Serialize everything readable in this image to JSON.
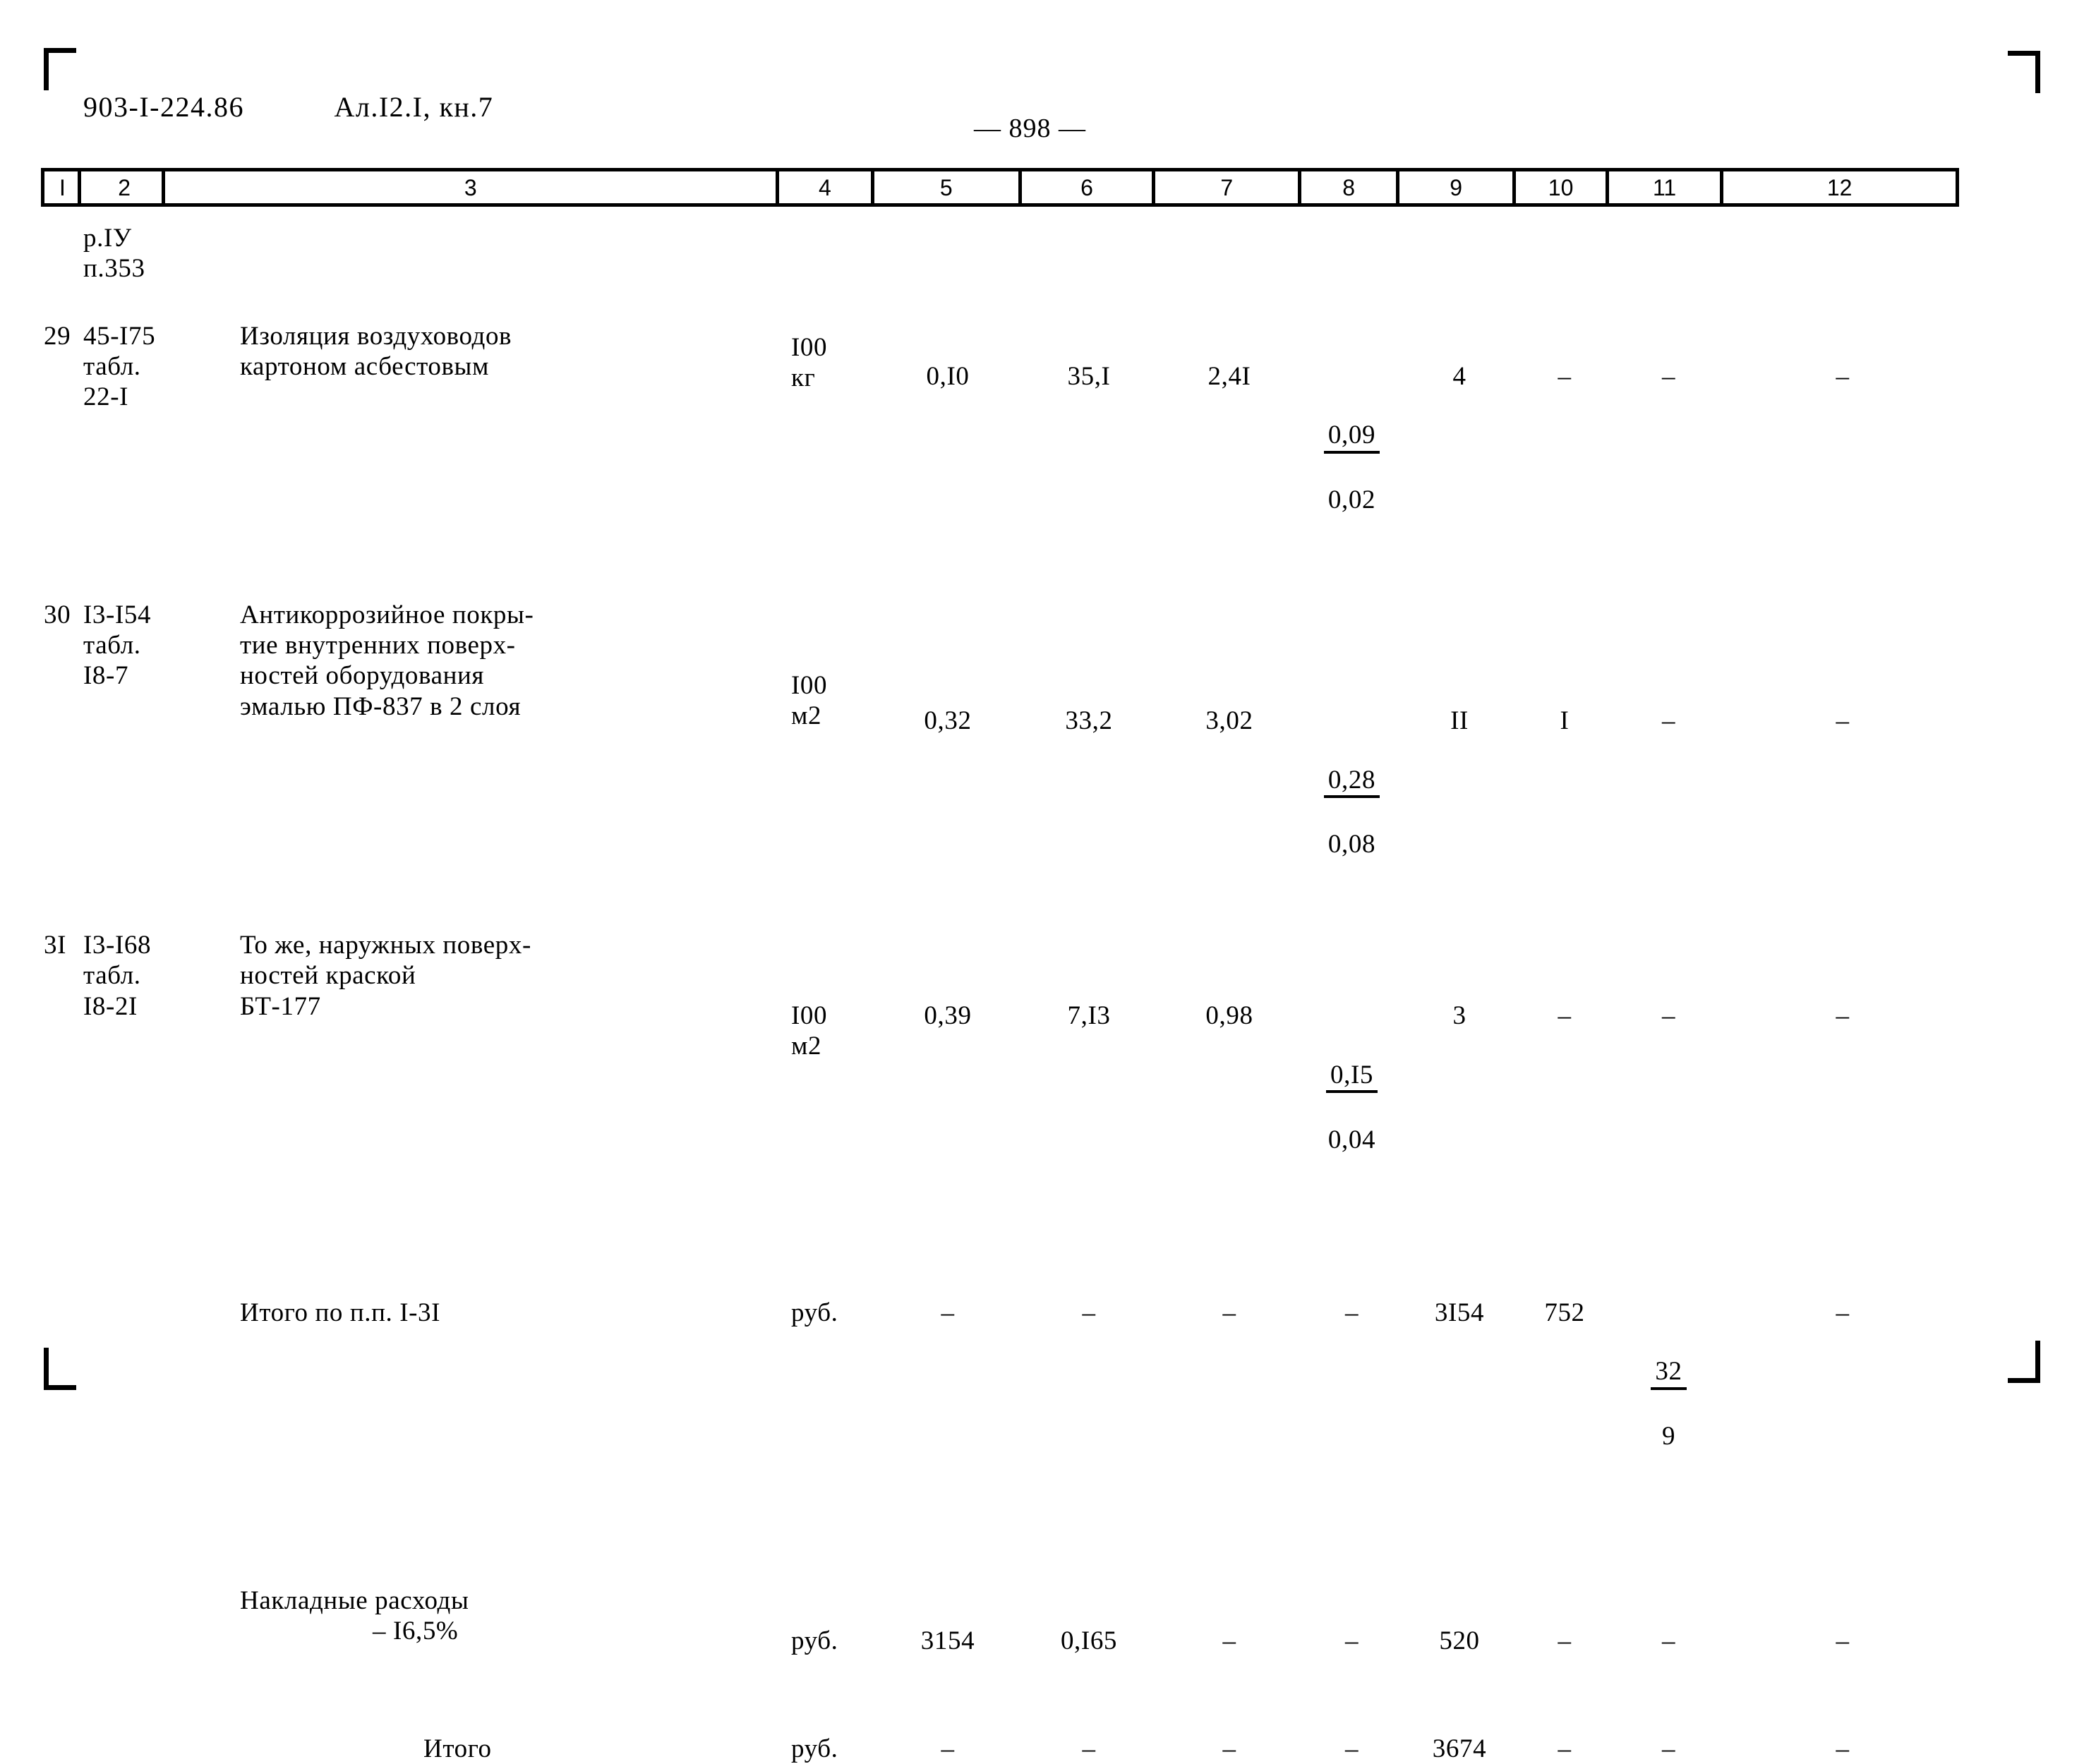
{
  "header": {
    "doc_code": "903-I-224.86",
    "album": "Ал.I2.I, кн.7",
    "page_number": "— 898 —"
  },
  "column_headers": [
    "I",
    "2",
    "3",
    "4",
    "5",
    "6",
    "7",
    "8",
    "9",
    "10",
    "11",
    "12"
  ],
  "section_ref": {
    "line1": "р.IУ",
    "line2": "п.353"
  },
  "rows": [
    {
      "num": "29",
      "code": "45-I75\nтабл.\n22-I",
      "desc": "Изоляция воздуховодов\nкартоном асбестовым",
      "unit": "I00\nкг",
      "c5": "0,I0",
      "c6": "35,I",
      "c7": "2,4I",
      "c8_top": "0,09",
      "c8_bot": "0,02",
      "c9": "4",
      "c10": "–",
      "c11": "–",
      "c12": "–"
    },
    {
      "num": "30",
      "code": "I3-I54\nтабл.\nI8-7",
      "desc": "Антикоррозийное покры-\nтие внутренних поверх-\nностей оборудования\nэмалью ПФ-837 в 2 слоя",
      "unit": "I00\nм2",
      "c5": "0,32",
      "c6": "33,2",
      "c7": "3,02",
      "c8_top": "0,28",
      "c8_bot": "0,08",
      "c9": "II",
      "c10": "I",
      "c11": "–",
      "c12": "–"
    },
    {
      "num": "3I",
      "code": "I3-I68\nтабл.\nI8-2I",
      "desc": "То же, наружных поверх-\nностей краской\n  БТ-177",
      "unit": "I00\nм2",
      "c5": "0,39",
      "c6": "7,I3",
      "c7": "0,98",
      "c8_top": "0,I5",
      "c8_bot": "0,04",
      "c9": "3",
      "c10": "–",
      "c11": "–",
      "c12": "–"
    }
  ],
  "summary": {
    "total_items": {
      "label": "Итого по п.п. I-3I",
      "unit": "руб.",
      "c5": "–",
      "c6": "–",
      "c7": "–",
      "c8": "–",
      "c9": "3I54",
      "c10": "752",
      "c11_top": "32",
      "c11_bot": "9",
      "c12": "–"
    },
    "overhead": {
      "label_line1": "Накладные расходы",
      "label_line2": "– I6,5%",
      "unit": "руб.",
      "c5": "3154",
      "c6": "0,I65",
      "c7": "–",
      "c8": "–",
      "c9": "520",
      "c10": "–",
      "c11": "–",
      "c12": "–"
    },
    "grand_total": {
      "label": "Итого",
      "unit": "руб.",
      "c5": "–",
      "c6": "–",
      "c7": "–",
      "c8": "–",
      "c9": "3674",
      "c10": "–",
      "c11": "–",
      "c12": "–"
    }
  }
}
